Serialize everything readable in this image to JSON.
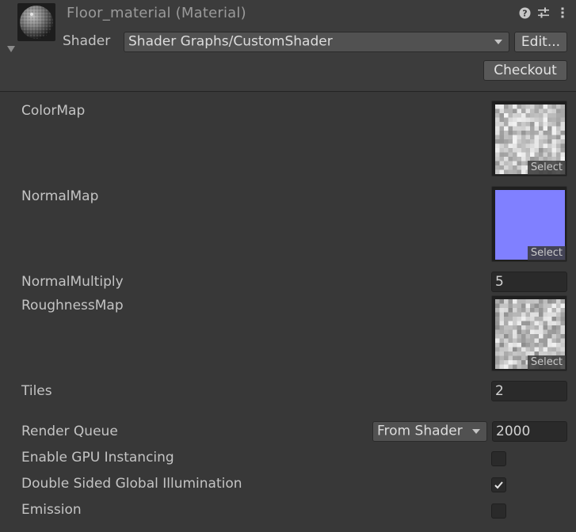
{
  "header": {
    "title": "Floor_material (Material)",
    "shader_label": "Shader",
    "shader_value": "Shader Graphs/CustomShader",
    "edit_button": "Edit...",
    "checkout_button": "Checkout",
    "icons": [
      "help-icon",
      "preset-sliders-icon",
      "kebab-menu-icon",
      "foldout-arrow-icon"
    ]
  },
  "properties": [
    {
      "label": "ColorMap",
      "type": "texture",
      "select_label": "Select"
    },
    {
      "label": "NormalMap",
      "type": "texture",
      "select_label": "Select",
      "color": "#8080ff"
    },
    {
      "label": "NormalMultiply",
      "type": "number",
      "value": "5"
    },
    {
      "label": "RoughnessMap",
      "type": "texture",
      "select_label": "Select"
    },
    {
      "label": "Tiles",
      "type": "number",
      "value": "2"
    }
  ],
  "render_queue": {
    "label": "Render Queue",
    "dropdown_value": "From Shader",
    "value": "2000"
  },
  "toggles": [
    {
      "label": "Enable GPU Instancing",
      "checked": false
    },
    {
      "label": "Double Sided Global Illumination",
      "checked": true
    },
    {
      "label": "Emission",
      "checked": false
    }
  ],
  "colors": {
    "background": "#383838",
    "header_background": "#3c3c3c",
    "normal_map": "#8080ff"
  }
}
